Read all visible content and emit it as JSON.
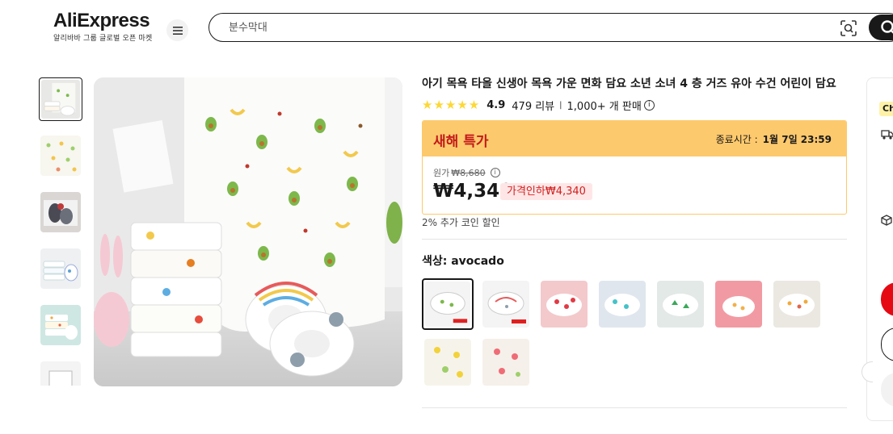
{
  "header": {
    "logo_text": "AliExpress",
    "logo_tagline": "알리바바 그룹 글로벌 오픈 마켓",
    "search_placeholder": "분수막대"
  },
  "product": {
    "title": "아기 목욕 타올 신생아 목욕 가운 면화 담요 소년 소녀 4 층 거즈 유아 수건 어린이 담요",
    "rating": "4.9",
    "stars": "★★★★★",
    "reviews": "479 리뷰",
    "sold": "1,000+ 개 판매",
    "deal": {
      "name": "새해 특가",
      "ends_label": "종료시간 :",
      "ends_time": "1월 7일 23:59",
      "original_label": "원가",
      "original_price": "₩8,680",
      "price": "₩4,340",
      "discount": "가격인하₩4,340"
    },
    "coin_note": "2% 추가 코인 할인",
    "color_label": "색상: avocado"
  },
  "right_panel": {
    "badge": "Ch"
  },
  "colors": {
    "deal_header": "#fdc96d",
    "deal_name": "#c21a1a",
    "star": "#fdd835",
    "buy_button": "#e50914"
  }
}
